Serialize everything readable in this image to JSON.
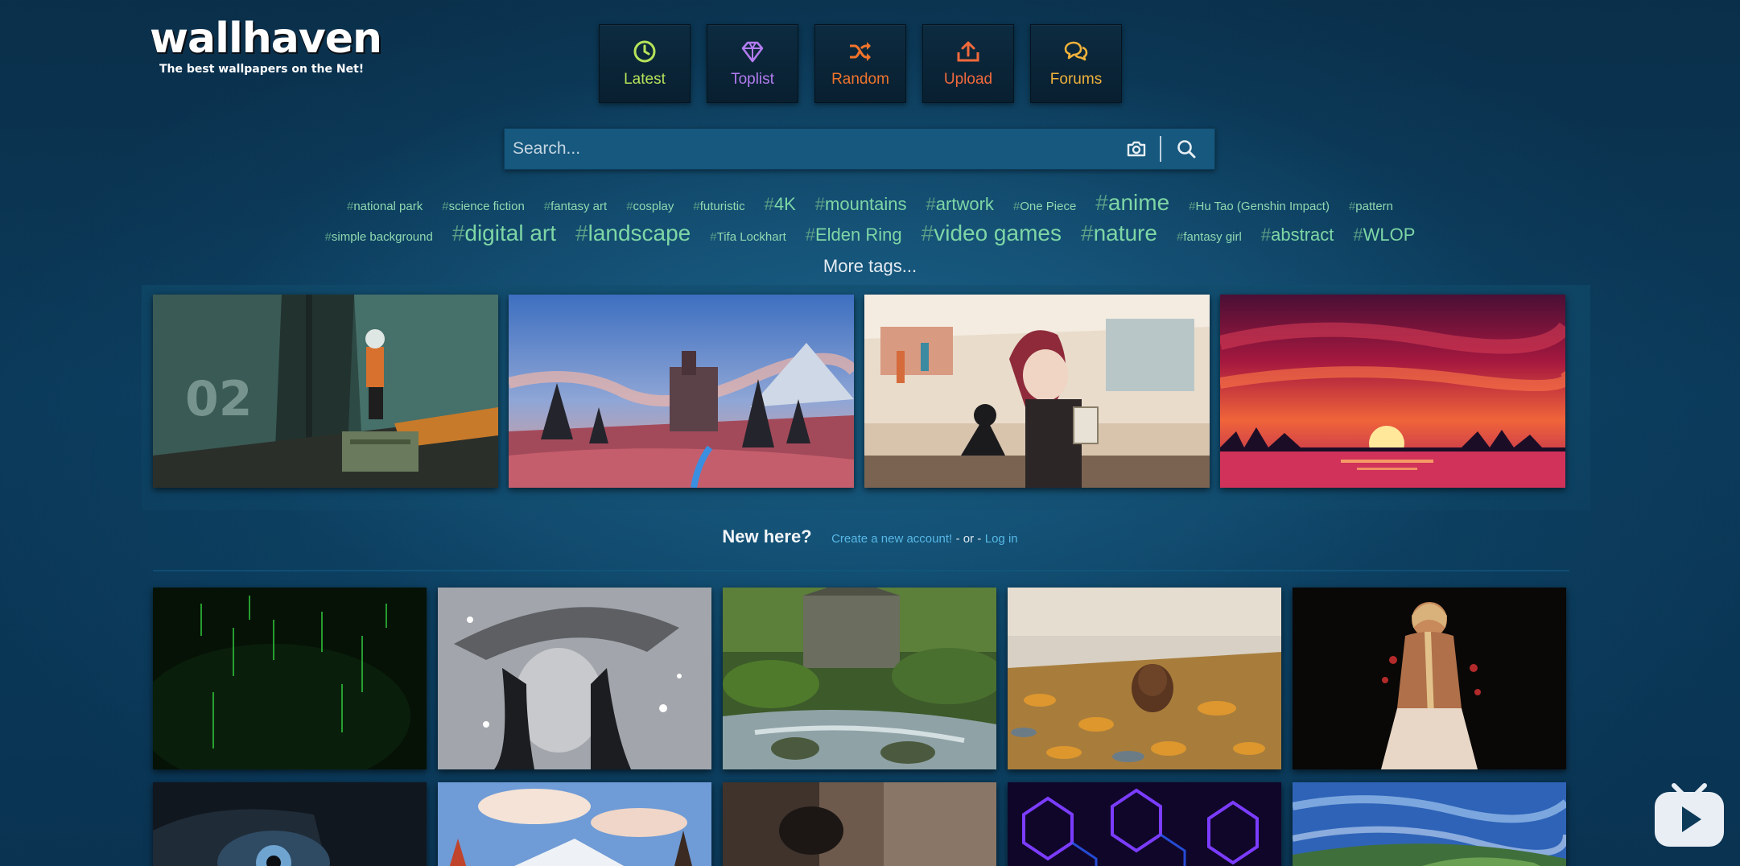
{
  "site": {
    "logo": "wallhaven",
    "tagline": "The best wallpapers on the Net!"
  },
  "nav": [
    {
      "label": "Latest",
      "icon": "clock-icon",
      "color": "#b6e35a"
    },
    {
      "label": "Toplist",
      "icon": "diamond-icon",
      "color": "#b37cf0"
    },
    {
      "label": "Random",
      "icon": "shuffle-icon",
      "color": "#f0742c"
    },
    {
      "label": "Upload",
      "icon": "upload-icon",
      "color": "#f26a3c"
    },
    {
      "label": "Forums",
      "icon": "chat-bubbles-icon",
      "color": "#f0b23a"
    }
  ],
  "search": {
    "placeholder": "Search...",
    "camera_icon": "camera-icon",
    "search_icon": "search-icon"
  },
  "tags_row1": [
    {
      "name": "national park",
      "size": "xs"
    },
    {
      "name": "science fiction",
      "size": "xs"
    },
    {
      "name": "fantasy art",
      "size": "xs"
    },
    {
      "name": "cosplay",
      "size": "xs"
    },
    {
      "name": "futuristic",
      "size": "xs"
    },
    {
      "name": "4K",
      "size": "md"
    },
    {
      "name": "mountains",
      "size": "md"
    },
    {
      "name": "artwork",
      "size": "md"
    },
    {
      "name": "One Piece",
      "size": "xs"
    },
    {
      "name": "anime",
      "size": "lg"
    },
    {
      "name": "Hu Tao (Genshin Impact)",
      "size": "xs"
    },
    {
      "name": "pattern",
      "size": "xs"
    }
  ],
  "tags_row2": [
    {
      "name": "simple background",
      "size": "xs"
    },
    {
      "name": "digital art",
      "size": "lg"
    },
    {
      "name": "landscape",
      "size": "lg"
    },
    {
      "name": "Tifa Lockhart",
      "size": "xs"
    },
    {
      "name": "Elden Ring",
      "size": "md"
    },
    {
      "name": "video games",
      "size": "lg"
    },
    {
      "name": "nature",
      "size": "lg"
    },
    {
      "name": "fantasy girl",
      "size": "xs"
    },
    {
      "name": "abstract",
      "size": "md"
    },
    {
      "name": "WLOP",
      "size": "md"
    }
  ],
  "more_tags": "More tags...",
  "featured": [
    {
      "subject": "anime-girl-on-train-platform"
    },
    {
      "subject": "castle-landscape-sunset"
    },
    {
      "subject": "anime-girl-with-cat-market"
    },
    {
      "subject": "sunset-over-lake"
    }
  ],
  "new_here": {
    "question": "New here?",
    "create_link": "Create a new account!",
    "or_text": "- or -",
    "login_link": "Log in"
  },
  "grid_row1": [
    {
      "subject": "green-matrix-rain"
    },
    {
      "subject": "anime-girl-with-hat-snow"
    },
    {
      "subject": "mossy-stream-forest"
    },
    {
      "subject": "pinecone-autumn-leaves"
    },
    {
      "subject": "woman-with-braid-dark"
    }
  ],
  "grid_row2": [
    {
      "subject": "eye-closeup"
    },
    {
      "subject": "snowy-mountain-forest"
    },
    {
      "subject": "dark-portrait"
    },
    {
      "subject": "neon-hexagons"
    },
    {
      "subject": "sky-landscape"
    }
  ],
  "overlay_badge": {
    "icon": "play-tv-icon"
  }
}
